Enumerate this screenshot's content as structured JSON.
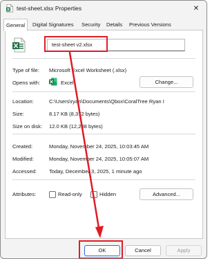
{
  "window": {
    "title": "test-sheet.xlsx Properties",
    "icon": "excel-file-icon",
    "close_glyph": "✕"
  },
  "tabs": [
    "General",
    "Digital Signatures",
    "Security",
    "Details",
    "Previous Versions"
  ],
  "general": {
    "filename": "test-sheet v2.xlsx",
    "file_icon": "excel-file-icon",
    "type_label": "Type of file:",
    "type_value": "Microsoft Excel Worksheet (.xlsx)",
    "opens_label": "Opens with:",
    "opens_value": "Excel",
    "change_button": "Change...",
    "location_label": "Location:",
    "location_value": "C:\\Users\\ryan\\Documents\\Qbox\\CoralTree Ryan I",
    "size_label": "Size:",
    "size_value": "8.17 KB (8,372 bytes)",
    "size_on_disk_label": "Size on disk:",
    "size_on_disk_value": "12.0 KB (12,288 bytes)",
    "created_label": "Created:",
    "created_value": "Monday, November 24, 2025, 10:03:45 AM",
    "modified_label": "Modified:",
    "modified_value": "Monday, November 24, 2025, 10:05:07 AM",
    "accessed_label": "Accessed:",
    "accessed_value": "Today, December 3, 2025, 1 minute ago",
    "attributes_label": "Attributes:",
    "readonly_label": "Read-only",
    "hidden_label": "Hidden",
    "advanced_button": "Advanced..."
  },
  "footer": {
    "ok": "OK",
    "cancel": "Cancel",
    "apply": "Apply"
  },
  "colors": {
    "highlight": "#e01b24",
    "excel_green": "#1d7044"
  }
}
